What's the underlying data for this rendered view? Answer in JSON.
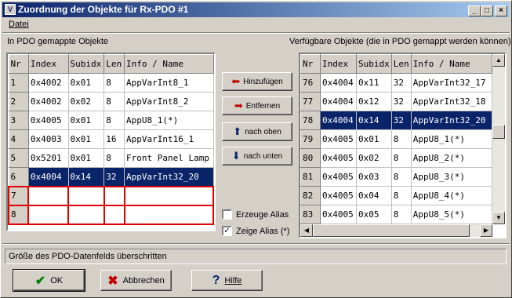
{
  "window": {
    "title": "Zuordnung der Objekte für Rx-PDO #1",
    "title_icon": "app-icon",
    "controls": [
      "_",
      "□",
      "×"
    ]
  },
  "menu": {
    "file": "Datei"
  },
  "left": {
    "heading": "In PDO gemappte Objekte",
    "columns": [
      "Nr",
      "Index",
      "Subidx",
      "Len",
      "Info / Name"
    ],
    "rows": [
      {
        "nr": "1",
        "index": "0x4002",
        "subidx": "0x01",
        "len": "8",
        "name": "AppVarInt8_1"
      },
      {
        "nr": "2",
        "index": "0x4002",
        "subidx": "0x02",
        "len": "8",
        "name": "AppVarInt8_2"
      },
      {
        "nr": "3",
        "index": "0x4005",
        "subidx": "0x01",
        "len": "8",
        "name": "AppU8_1(*)"
      },
      {
        "nr": "4",
        "index": "0x4003",
        "subidx": "0x01",
        "len": "16",
        "name": "AppVarInt16_1"
      },
      {
        "nr": "5",
        "index": "0x5201",
        "subidx": "0x01",
        "len": "8",
        "name": "Front Panel Lamp"
      },
      {
        "nr": "6",
        "index": "0x4004",
        "subidx": "0x14",
        "len": "32",
        "name": "AppVarInt32_20"
      },
      {
        "nr": "7",
        "index": "",
        "subidx": "",
        "len": "",
        "name": ""
      },
      {
        "nr": "8",
        "index": "",
        "subidx": "",
        "len": "",
        "name": ""
      }
    ]
  },
  "right": {
    "heading": "Verfügbare Objekte (die in PDO gemappt werden können)",
    "columns": [
      "Nr",
      "Index",
      "Subidx",
      "Len",
      "Info / Name"
    ],
    "rows": [
      {
        "nr": "76",
        "index": "0x4004",
        "subidx": "0x11",
        "len": "32",
        "name": "AppVarInt32_17"
      },
      {
        "nr": "77",
        "index": "0x4004",
        "subidx": "0x12",
        "len": "32",
        "name": "AppVarInt32_18"
      },
      {
        "nr": "78",
        "index": "0x4004",
        "subidx": "0x14",
        "len": "32",
        "name": "AppVarInt32_20"
      },
      {
        "nr": "79",
        "index": "0x4005",
        "subidx": "0x01",
        "len": "8",
        "name": "AppU8_1(*)"
      },
      {
        "nr": "80",
        "index": "0x4005",
        "subidx": "0x02",
        "len": "8",
        "name": "AppU8_2(*)"
      },
      {
        "nr": "81",
        "index": "0x4005",
        "subidx": "0x03",
        "len": "8",
        "name": "AppU8_3(*)"
      },
      {
        "nr": "82",
        "index": "0x4005",
        "subidx": "0x04",
        "len": "8",
        "name": "AppU8_4(*)"
      },
      {
        "nr": "83",
        "index": "0x4005",
        "subidx": "0x05",
        "len": "8",
        "name": "AppU8_5(*)"
      }
    ]
  },
  "actions": {
    "add": "Hinzufügen",
    "remove": "Entfernen",
    "up": "nach oben",
    "down": "nach unten"
  },
  "options": {
    "create_alias": "Erzeuge Alias",
    "create_alias_checked": false,
    "show_alias": "Zeige Alias (*)",
    "show_alias_checked": true
  },
  "status": "Größe des PDO-Datenfelds überschritten",
  "buttons": {
    "ok": "OK",
    "cancel": "Abbrechen",
    "help": "Hilfe"
  },
  "colors": {
    "selection": "#0a246a",
    "error_border": "#e00000",
    "ok_check": "#008000",
    "cancel_x": "#c00000"
  }
}
